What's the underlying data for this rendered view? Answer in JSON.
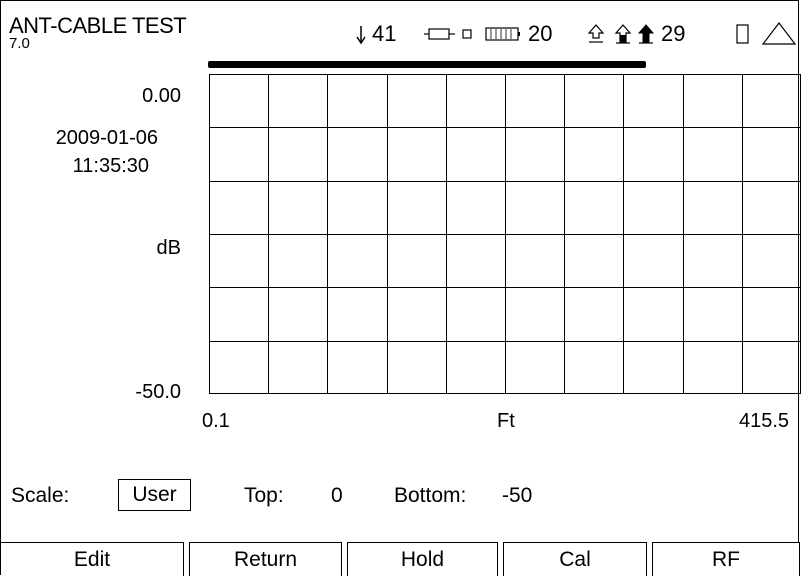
{
  "header": {
    "title": "ANT-CABLE TEST",
    "version": "7.0"
  },
  "status": {
    "signal_value": "41",
    "battery_value": "20",
    "temp_value": "29",
    "icons": [
      "down-arrow-icon",
      "cable-icon",
      "small-square-icon",
      "battery-icon",
      "up-arrow-outline-icon",
      "up-arrow-half-icon",
      "up-arrow-filled-icon",
      "empty-rectangle-icon",
      "triangle-icon"
    ]
  },
  "progress": {
    "fraction": 0.74
  },
  "chart": {
    "y_top": "0.00",
    "y_bottom": "-50.0",
    "y_unit": "dB",
    "date": "2009-01-06",
    "time": "11:35:30",
    "x_start": "0.1",
    "x_unit": "Ft",
    "x_end": "415.5"
  },
  "chart_data": {
    "type": "line",
    "title": "",
    "xlabel": "Ft",
    "ylabel": "dB",
    "xlim": [
      0.1,
      415.5
    ],
    "ylim": [
      -50,
      0
    ],
    "grid": true,
    "grid_columns": 10,
    "grid_rows": 6,
    "series": []
  },
  "scale": {
    "label": "Scale:",
    "mode": "User",
    "top_label": "Top:",
    "top_value": "0",
    "bottom_label": "Bottom:",
    "bottom_value": "-50"
  },
  "softkeys": [
    "Edit",
    "Return",
    "Hold",
    "Cal",
    "RF"
  ]
}
